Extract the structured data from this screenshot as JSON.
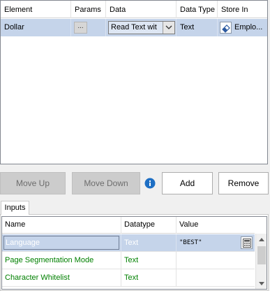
{
  "top_grid": {
    "columns": [
      "Element",
      "Params",
      "Data",
      "Data Type",
      "Store In"
    ],
    "row": {
      "element": "Dollar",
      "params": "...",
      "data": "Read  Text wit",
      "data_type": "Text",
      "store_in": "Emplo..."
    }
  },
  "buttons": {
    "move_up": "Move Up",
    "move_down": "Move Down",
    "add": "Add",
    "remove": "Remove"
  },
  "tabs": [
    "Inputs"
  ],
  "inputs_grid": {
    "columns": [
      "Name",
      "Datatype",
      "Value"
    ],
    "rows": [
      {
        "name": "Language",
        "datatype": "Text",
        "value": "\"BEST\""
      },
      {
        "name": "Page Segmentation Mode",
        "datatype": "Text",
        "value": ""
      },
      {
        "name": "Character Whitelist",
        "datatype": "Text",
        "value": ""
      }
    ]
  },
  "colors": {
    "selection": "#c5d4ea",
    "input_text_green": "#008000",
    "info_blue": "#1e6fc4"
  },
  "icons": [
    "chevron-down-icon",
    "eraser-icon",
    "info-icon",
    "calculator-icon",
    "scroll-up-icon",
    "scroll-down-icon"
  ]
}
